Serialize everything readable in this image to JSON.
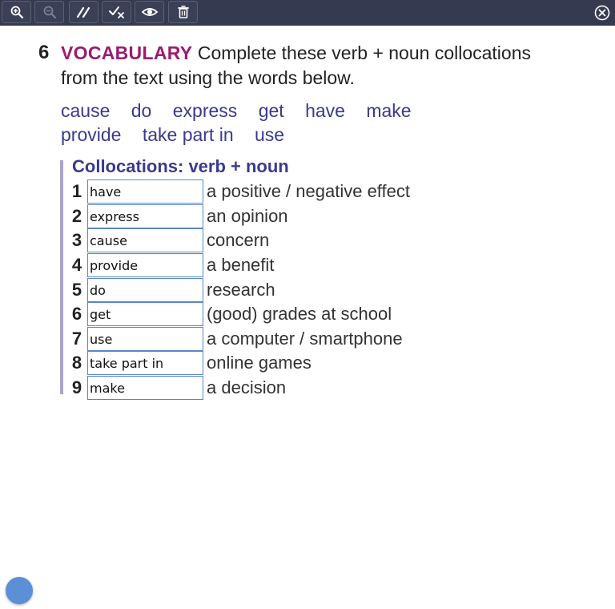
{
  "toolbar": {
    "buttons": [
      {
        "icon": "zoom-in-icon",
        "enabled": true
      },
      {
        "icon": "zoom-out-icon",
        "enabled": false
      },
      {
        "icon": "pen-icon",
        "enabled": true
      },
      {
        "icon": "check-answers-icon",
        "enabled": true
      },
      {
        "icon": "show-answers-icon",
        "enabled": true
      },
      {
        "icon": "trash-icon",
        "enabled": true
      }
    ],
    "close_icon": "close-icon"
  },
  "exercise": {
    "number": "6",
    "tag": "VOCABULARY",
    "instruction_line1": "Complete these verb + noun collocations",
    "instruction_line2": "from the text using the words below.",
    "word_bank_row1": [
      "cause",
      "do",
      "express",
      "get",
      "have",
      "make"
    ],
    "word_bank_row2": [
      "provide",
      "take part in",
      "use"
    ],
    "box_title": "Collocations: verb + noun",
    "items": [
      {
        "num": "1",
        "answer": "have",
        "phrase": "a positive / negative effect"
      },
      {
        "num": "2",
        "answer": "express",
        "phrase": "an opinion"
      },
      {
        "num": "3",
        "answer": "cause",
        "phrase": "concern"
      },
      {
        "num": "4",
        "answer": "provide",
        "phrase": "a benefit"
      },
      {
        "num": "5",
        "answer": "do",
        "phrase": "research"
      },
      {
        "num": "6",
        "answer": "get",
        "phrase": "(good) grades at school"
      },
      {
        "num": "7",
        "answer": "use",
        "phrase": "a computer / smartphone"
      },
      {
        "num": "8",
        "answer": "take part in",
        "phrase": "online games"
      },
      {
        "num": "9",
        "answer": "make",
        "phrase": "a decision"
      }
    ]
  },
  "colors": {
    "toolbar_bg": "#353a50",
    "accent_magenta": "#9b1c6d",
    "word_blue": "#3a3a8f",
    "input_border": "#5a86c8",
    "fab": "#5b8fd6"
  }
}
